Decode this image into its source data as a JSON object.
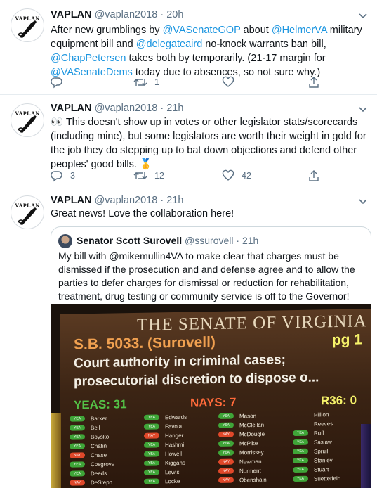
{
  "tweets": [
    {
      "name": "VAPLAN",
      "handle": "@vaplan2018",
      "dot": "·",
      "time": "20h",
      "text_parts": [
        {
          "t": "After new grumblings by ",
          "link": false
        },
        {
          "t": "@VASenateGOP",
          "link": true
        },
        {
          "t": " about ",
          "link": false
        },
        {
          "t": "@HelmerVA",
          "link": true
        },
        {
          "t": " military equipment bill and ",
          "link": false
        },
        {
          "t": "@delegateaird",
          "link": true
        },
        {
          "t": " no-knock warrants ban bill, ",
          "link": false
        },
        {
          "t": "@ChapPetersen",
          "link": true
        },
        {
          "t": " takes both by temporarily. (21-17 margin for ",
          "link": false
        },
        {
          "t": "@VASenateDems",
          "link": true
        },
        {
          "t": " today due to absences, so not sure why.)",
          "link": false
        }
      ],
      "reply_count": "",
      "retweet_count": "1",
      "like_count": ""
    },
    {
      "name": "VAPLAN",
      "handle": "@vaplan2018",
      "dot": "·",
      "time": "21h",
      "text_parts": [
        {
          "t": "👀 This doesn't show up in votes or other legislator stats/scorecards (including mine), but some legislators are worth their weight in gold for the job they do stepping up to bat down objections and defend other peoples' good bills. 🥇",
          "link": false
        }
      ],
      "reply_count": "3",
      "retweet_count": "12",
      "like_count": "42"
    },
    {
      "name": "VAPLAN",
      "handle": "@vaplan2018",
      "dot": "·",
      "time": "21h",
      "text_parts": [
        {
          "t": "Great news! Love the collaboration here!",
          "link": false
        }
      ]
    }
  ],
  "avatar_logo_text": "VAPLAN",
  "quote": {
    "name": "Senator Scott Surovell",
    "handle": "@ssurovell",
    "dot": "·",
    "time": "21h",
    "text": "My bill with @mikemullin4VA to make clear that charges must be dismissed if the prosecution and and defense agree and to allow the parties to defer charges for dismissal or reduction for rehabilitation, treatment, drug testing or community service is off to the Governor!"
  },
  "photo": {
    "title": "THE SENATE OF VIRGINIA",
    "bill": "S.B. 5033. (Surovell)",
    "page": "pg 1",
    "subject_line1": "Court authority in criminal cases;",
    "subject_line2": "prosecutorial discretion to dispose o...",
    "yeas": "YEAS: 31",
    "nays": "NAYS: 7",
    "r36": "R36: 0",
    "votes": [
      {
        "col": 0,
        "vote": "YEA",
        "name": "Barker"
      },
      {
        "col": 0,
        "vote": "YEA",
        "name": "Bell"
      },
      {
        "col": 0,
        "vote": "YEA",
        "name": "Boysko"
      },
      {
        "col": 0,
        "vote": "YEA",
        "name": "Chafin"
      },
      {
        "col": 0,
        "vote": "NAY",
        "name": "Chase"
      },
      {
        "col": 0,
        "vote": "YEA",
        "name": "Cosgrove"
      },
      {
        "col": 0,
        "vote": "YEA",
        "name": "Deeds"
      },
      {
        "col": 0,
        "vote": "NAY",
        "name": "DeSteph"
      },
      {
        "col": 1,
        "vote": "YEA",
        "name": "Edwards"
      },
      {
        "col": 1,
        "vote": "YEA",
        "name": "Favola"
      },
      {
        "col": 1,
        "vote": "NAY",
        "name": "Hanger"
      },
      {
        "col": 1,
        "vote": "YEA",
        "name": "Hashmi"
      },
      {
        "col": 1,
        "vote": "YEA",
        "name": "Howell"
      },
      {
        "col": 1,
        "vote": "YEA",
        "name": "Kiggans"
      },
      {
        "col": 1,
        "vote": "YEA",
        "name": "Lewis"
      },
      {
        "col": 1,
        "vote": "YEA",
        "name": "Locke"
      },
      {
        "col": 2,
        "vote": "YEA",
        "name": "Mason"
      },
      {
        "col": 2,
        "vote": "YEA",
        "name": "McClellan"
      },
      {
        "col": 2,
        "vote": "NAY",
        "name": "McDougle"
      },
      {
        "col": 2,
        "vote": "YEA",
        "name": "McPike"
      },
      {
        "col": 2,
        "vote": "YEA",
        "name": "Morrissey"
      },
      {
        "col": 2,
        "vote": "NAY",
        "name": "Newman"
      },
      {
        "col": 2,
        "vote": "NAY",
        "name": "Norment"
      },
      {
        "col": 2,
        "vote": "NAY",
        "name": "Obenshain"
      },
      {
        "col": 3,
        "vote": "",
        "name": "Pillion"
      },
      {
        "col": 3,
        "vote": "",
        "name": "Reeves"
      },
      {
        "col": 3,
        "vote": "YEA",
        "name": "Ruff"
      },
      {
        "col": 3,
        "vote": "YEA",
        "name": "Saslaw"
      },
      {
        "col": 3,
        "vote": "YEA",
        "name": "Spruill"
      },
      {
        "col": 3,
        "vote": "YEA",
        "name": "Stanley"
      },
      {
        "col": 3,
        "vote": "YEA",
        "name": "Stuart"
      },
      {
        "col": 3,
        "vote": "YEA",
        "name": "Suetterlein"
      }
    ]
  },
  "colors": {
    "link": "#1b95e0",
    "muted": "#5b7083",
    "divider": "#e6ecf0"
  },
  "icons": [
    "chevron-down-icon",
    "reply-icon",
    "retweet-icon",
    "like-icon",
    "share-icon"
  ]
}
